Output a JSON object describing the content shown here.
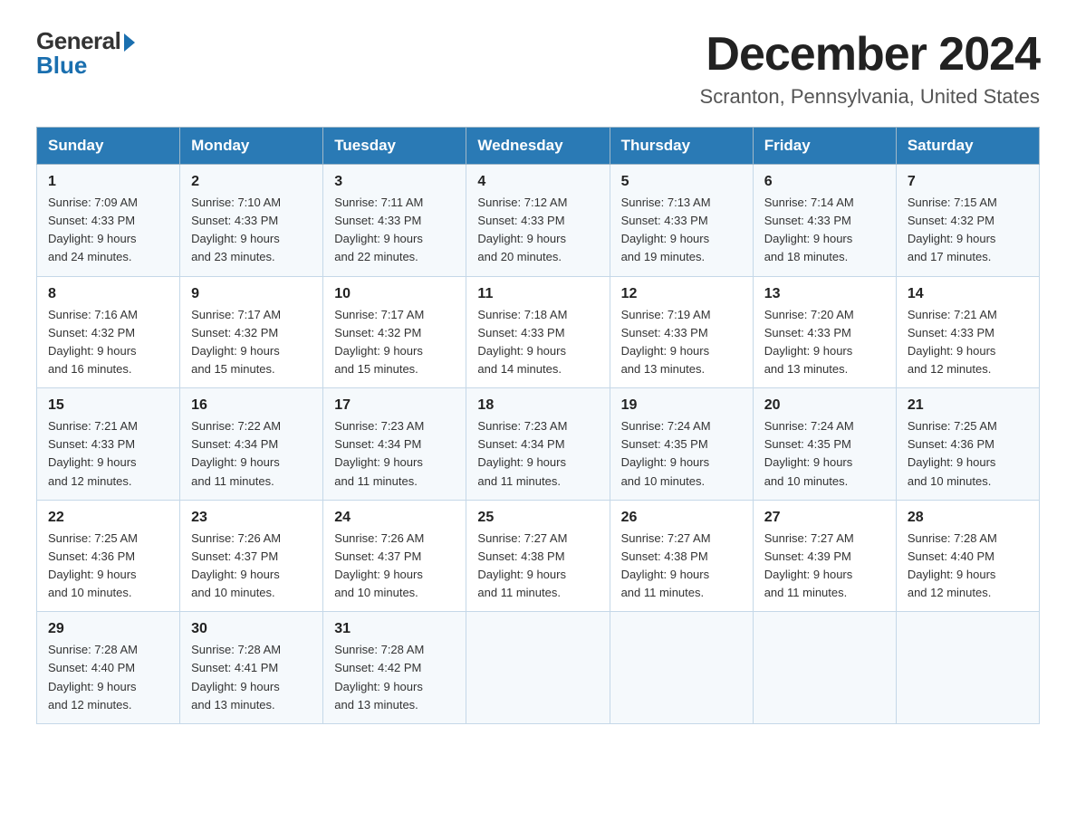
{
  "header": {
    "logo_general": "General",
    "logo_blue": "Blue",
    "month_title": "December 2024",
    "location": "Scranton, Pennsylvania, United States"
  },
  "weekdays": [
    "Sunday",
    "Monday",
    "Tuesday",
    "Wednesday",
    "Thursday",
    "Friday",
    "Saturday"
  ],
  "weeks": [
    [
      {
        "day": "1",
        "sunrise": "7:09 AM",
        "sunset": "4:33 PM",
        "daylight": "9 hours and 24 minutes."
      },
      {
        "day": "2",
        "sunrise": "7:10 AM",
        "sunset": "4:33 PM",
        "daylight": "9 hours and 23 minutes."
      },
      {
        "day": "3",
        "sunrise": "7:11 AM",
        "sunset": "4:33 PM",
        "daylight": "9 hours and 22 minutes."
      },
      {
        "day": "4",
        "sunrise": "7:12 AM",
        "sunset": "4:33 PM",
        "daylight": "9 hours and 20 minutes."
      },
      {
        "day": "5",
        "sunrise": "7:13 AM",
        "sunset": "4:33 PM",
        "daylight": "9 hours and 19 minutes."
      },
      {
        "day": "6",
        "sunrise": "7:14 AM",
        "sunset": "4:33 PM",
        "daylight": "9 hours and 18 minutes."
      },
      {
        "day": "7",
        "sunrise": "7:15 AM",
        "sunset": "4:32 PM",
        "daylight": "9 hours and 17 minutes."
      }
    ],
    [
      {
        "day": "8",
        "sunrise": "7:16 AM",
        "sunset": "4:32 PM",
        "daylight": "9 hours and 16 minutes."
      },
      {
        "day": "9",
        "sunrise": "7:17 AM",
        "sunset": "4:32 PM",
        "daylight": "9 hours and 15 minutes."
      },
      {
        "day": "10",
        "sunrise": "7:17 AM",
        "sunset": "4:32 PM",
        "daylight": "9 hours and 15 minutes."
      },
      {
        "day": "11",
        "sunrise": "7:18 AM",
        "sunset": "4:33 PM",
        "daylight": "9 hours and 14 minutes."
      },
      {
        "day": "12",
        "sunrise": "7:19 AM",
        "sunset": "4:33 PM",
        "daylight": "9 hours and 13 minutes."
      },
      {
        "day": "13",
        "sunrise": "7:20 AM",
        "sunset": "4:33 PM",
        "daylight": "9 hours and 13 minutes."
      },
      {
        "day": "14",
        "sunrise": "7:21 AM",
        "sunset": "4:33 PM",
        "daylight": "9 hours and 12 minutes."
      }
    ],
    [
      {
        "day": "15",
        "sunrise": "7:21 AM",
        "sunset": "4:33 PM",
        "daylight": "9 hours and 12 minutes."
      },
      {
        "day": "16",
        "sunrise": "7:22 AM",
        "sunset": "4:34 PM",
        "daylight": "9 hours and 11 minutes."
      },
      {
        "day": "17",
        "sunrise": "7:23 AM",
        "sunset": "4:34 PM",
        "daylight": "9 hours and 11 minutes."
      },
      {
        "day": "18",
        "sunrise": "7:23 AM",
        "sunset": "4:34 PM",
        "daylight": "9 hours and 11 minutes."
      },
      {
        "day": "19",
        "sunrise": "7:24 AM",
        "sunset": "4:35 PM",
        "daylight": "9 hours and 10 minutes."
      },
      {
        "day": "20",
        "sunrise": "7:24 AM",
        "sunset": "4:35 PM",
        "daylight": "9 hours and 10 minutes."
      },
      {
        "day": "21",
        "sunrise": "7:25 AM",
        "sunset": "4:36 PM",
        "daylight": "9 hours and 10 minutes."
      }
    ],
    [
      {
        "day": "22",
        "sunrise": "7:25 AM",
        "sunset": "4:36 PM",
        "daylight": "9 hours and 10 minutes."
      },
      {
        "day": "23",
        "sunrise": "7:26 AM",
        "sunset": "4:37 PM",
        "daylight": "9 hours and 10 minutes."
      },
      {
        "day": "24",
        "sunrise": "7:26 AM",
        "sunset": "4:37 PM",
        "daylight": "9 hours and 10 minutes."
      },
      {
        "day": "25",
        "sunrise": "7:27 AM",
        "sunset": "4:38 PM",
        "daylight": "9 hours and 11 minutes."
      },
      {
        "day": "26",
        "sunrise": "7:27 AM",
        "sunset": "4:38 PM",
        "daylight": "9 hours and 11 minutes."
      },
      {
        "day": "27",
        "sunrise": "7:27 AM",
        "sunset": "4:39 PM",
        "daylight": "9 hours and 11 minutes."
      },
      {
        "day": "28",
        "sunrise": "7:28 AM",
        "sunset": "4:40 PM",
        "daylight": "9 hours and 12 minutes."
      }
    ],
    [
      {
        "day": "29",
        "sunrise": "7:28 AM",
        "sunset": "4:40 PM",
        "daylight": "9 hours and 12 minutes."
      },
      {
        "day": "30",
        "sunrise": "7:28 AM",
        "sunset": "4:41 PM",
        "daylight": "9 hours and 13 minutes."
      },
      {
        "day": "31",
        "sunrise": "7:28 AM",
        "sunset": "4:42 PM",
        "daylight": "9 hours and 13 minutes."
      },
      null,
      null,
      null,
      null
    ]
  ],
  "labels": {
    "sunrise": "Sunrise:",
    "sunset": "Sunset:",
    "daylight": "Daylight:"
  }
}
